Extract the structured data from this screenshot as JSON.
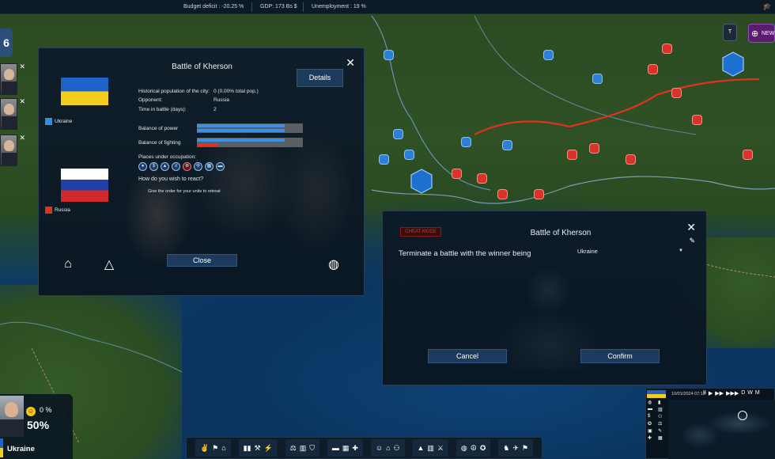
{
  "topbar": {
    "budget": "Budget deficit : -20.25 %",
    "gdp": "GDP:   173 Bs  $",
    "unemployment": "Unemployment :  19 %"
  },
  "top_right": {
    "news_label": "NEW",
    "small_label": "T"
  },
  "left": {
    "count": "6"
  },
  "battle_panel": {
    "title": "Battle of Kherson",
    "details_label": "Details",
    "side_a": "Ukraine",
    "side_b": "Russia",
    "hist_pop_label": "Historical population of the city:",
    "hist_pop_value": "0 (0.00% total pop.)",
    "opponent_label": "Opponent:",
    "opponent_value": "Russia",
    "time_label": "Time in battle (days):",
    "time_value": "2",
    "balance_power_label": "Balance of power",
    "balance_fighting_label": "Balance of fighting",
    "balance_power": 0.83,
    "balance_fighting": 0.2,
    "places_label": "Places under occupation:",
    "react_label": "How do you wish to react?",
    "react_option": "Give the order for your units to retreat",
    "close_label": "Close",
    "colors": {
      "ukraine": "#2f8fe6",
      "russia": "#e2321f"
    }
  },
  "terminate_panel": {
    "tag": "CHEAT MODE",
    "title": "Battle of Kherson",
    "label": "Terminate a battle with the winner being",
    "winner": "Ukraine",
    "cancel_label": "Cancel",
    "confirm_label": "Confirm"
  },
  "player": {
    "approval": "0 %",
    "percent": "50%",
    "country": "Ukraine"
  },
  "minimap": {
    "date": "10/01/2024  07:12",
    "speeds": [
      "II",
      "▶",
      "▶▶",
      "▶▶▶",
      "D",
      "W",
      "M"
    ]
  }
}
